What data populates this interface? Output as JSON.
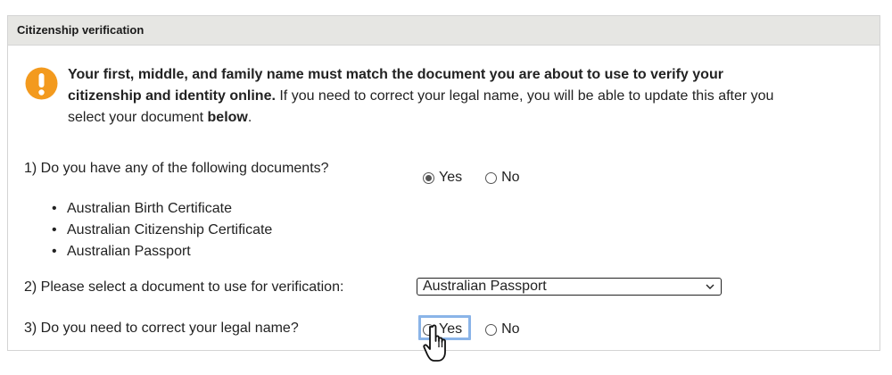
{
  "panel": {
    "title": "Citizenship verification"
  },
  "alert": {
    "icon": "exclamation-icon",
    "color": "#f39a1e",
    "bold_lead": "Your first, middle, and family name must match the document you are about to use to verify your citizenship and identity online.",
    "text_middle": " If you need to correct your legal name, you will be able to update this after you select your document ",
    "bold_tail": "below",
    "text_end": "."
  },
  "question1": {
    "label": "1) Do you have any of the following documents?",
    "options": [
      {
        "label": "Yes",
        "selected": true
      },
      {
        "label": "No",
        "selected": false
      }
    ],
    "documents": [
      "Australian Birth Certificate",
      "Australian Citizenship Certificate",
      "Australian Passport"
    ]
  },
  "question2": {
    "label": "2) Please select a document to use for verification:",
    "selected_value": "Australian Passport"
  },
  "question3": {
    "label": "3) Do you need to correct your legal name?",
    "options": [
      {
        "label": "Yes",
        "selected": false,
        "focused": true
      },
      {
        "label": "No",
        "selected": false
      }
    ]
  },
  "cursor": {
    "icon": "hand-pointer-icon"
  }
}
